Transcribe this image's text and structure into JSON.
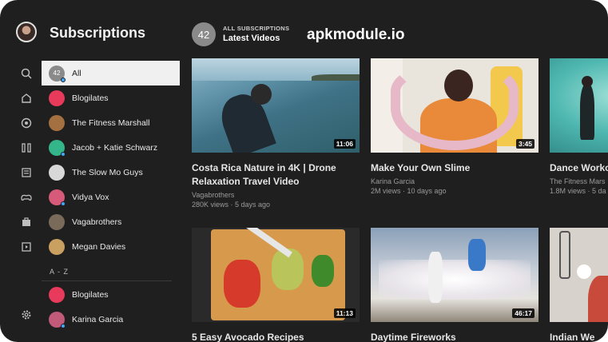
{
  "header": {
    "title": "Subscriptions",
    "count": "42",
    "small_label": "ALL SUBSCRIPTIONS",
    "main_label": "Latest Videos",
    "watermark": "apkmodule.io"
  },
  "rail_icons": [
    "search-icon",
    "home-icon",
    "explore-icon",
    "shorts-icon",
    "subscriptions-icon",
    "gaming-icon",
    "library-icon",
    "history-icon",
    "settings-icon"
  ],
  "channels": [
    {
      "name": "All",
      "avatar": "42",
      "color": "#8a8a8a",
      "selected": true,
      "dot": true
    },
    {
      "name": "Blogilates",
      "color": "#e83a5a"
    },
    {
      "name": "The Fitness Marshall",
      "color": "#a4703f"
    },
    {
      "name": "Jacob + Katie Schwarz",
      "color": "#35b58a",
      "dot": true
    },
    {
      "name": "The Slow Mo Guys",
      "color": "#d8d8d8"
    },
    {
      "name": "Vidya Vox",
      "color": "#d85a7a",
      "dot": true
    },
    {
      "name": "Vagabrothers",
      "color": "#7a6a5a"
    },
    {
      "name": "Megan Davies",
      "color": "#c9a060"
    }
  ],
  "az_label": "A - Z",
  "channels_az": [
    {
      "name": "Blogilates",
      "color": "#e83a5a"
    },
    {
      "name": "Karina Garcia",
      "color": "#c25a7a",
      "dot": true
    }
  ],
  "videos": [
    {
      "title": "Costa Rica Nature in 4K | Drone Relaxation Travel Video",
      "channel": "Vagabrothers",
      "meta": "280K views · 5 days ago",
      "duration": "11:06"
    },
    {
      "title": "Make Your Own Slime",
      "channel": "Karina Garcia",
      "meta": "2M views · 10 days ago",
      "duration": "3:45"
    },
    {
      "title": "Dance Worko",
      "channel": "The Fitness Mars",
      "meta": "1.8M views · 5 da",
      "duration": ""
    },
    {
      "title": "5 Easy Avocado Recipes",
      "channel": "",
      "meta": "",
      "duration": "11:13"
    },
    {
      "title": "Daytime Fireworks",
      "channel": "",
      "meta": "",
      "duration": "46:17"
    },
    {
      "title": "Indian We",
      "channel": "",
      "meta": "",
      "duration": ""
    }
  ]
}
